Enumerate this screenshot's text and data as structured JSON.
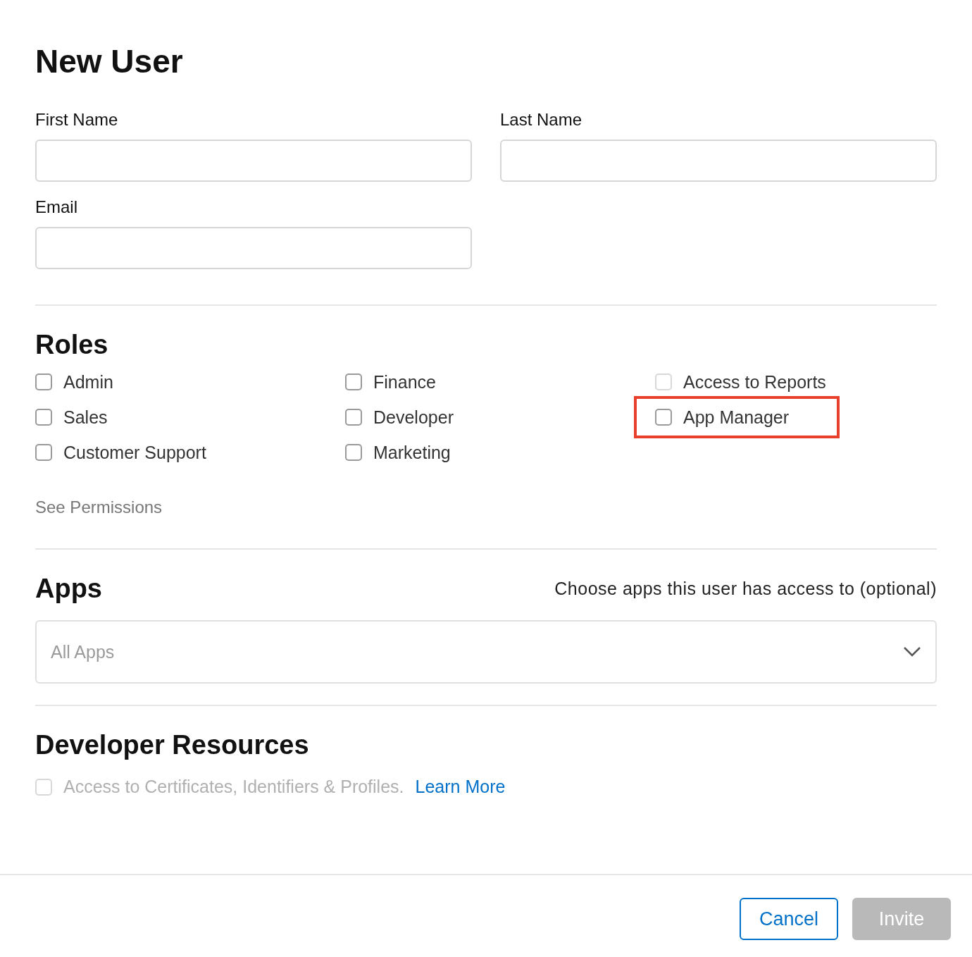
{
  "title": "New User",
  "fields": [
    {
      "label": "First Name"
    },
    {
      "label": "Last Name"
    },
    {
      "label": "Email"
    }
  ],
  "roles": {
    "title": "Roles",
    "items": [
      {
        "label": "Admin",
        "checked": false,
        "disabled": false,
        "highlighted": false
      },
      {
        "label": "Finance",
        "checked": false,
        "disabled": false,
        "highlighted": false
      },
      {
        "label": "Access to Reports",
        "checked": false,
        "disabled": true,
        "highlighted": false
      },
      {
        "label": "Sales",
        "checked": false,
        "disabled": false,
        "highlighted": false
      },
      {
        "label": "Developer",
        "checked": false,
        "disabled": false,
        "highlighted": false
      },
      {
        "label": "App Manager",
        "checked": false,
        "disabled": false,
        "highlighted": true
      },
      {
        "label": "Customer Support",
        "checked": false,
        "disabled": false,
        "highlighted": false
      },
      {
        "label": "Marketing",
        "checked": false,
        "disabled": false,
        "highlighted": false
      }
    ],
    "link": "See Permissions"
  },
  "apps": {
    "title": "Apps",
    "hint": "Choose apps this user has access to (optional)",
    "select": {
      "placeholder": "All Apps"
    }
  },
  "developer_resources": {
    "title": "Developer Resources",
    "option": {
      "label": "Access to Certificates, Identifiers & Profiles.",
      "checked": false,
      "disabled": true
    },
    "link": "Learn More"
  },
  "buttons": [
    {
      "label": "Cancel",
      "kind": "secondary",
      "disabled": false
    },
    {
      "label": "Invite",
      "kind": "primary",
      "disabled": true
    }
  ]
}
